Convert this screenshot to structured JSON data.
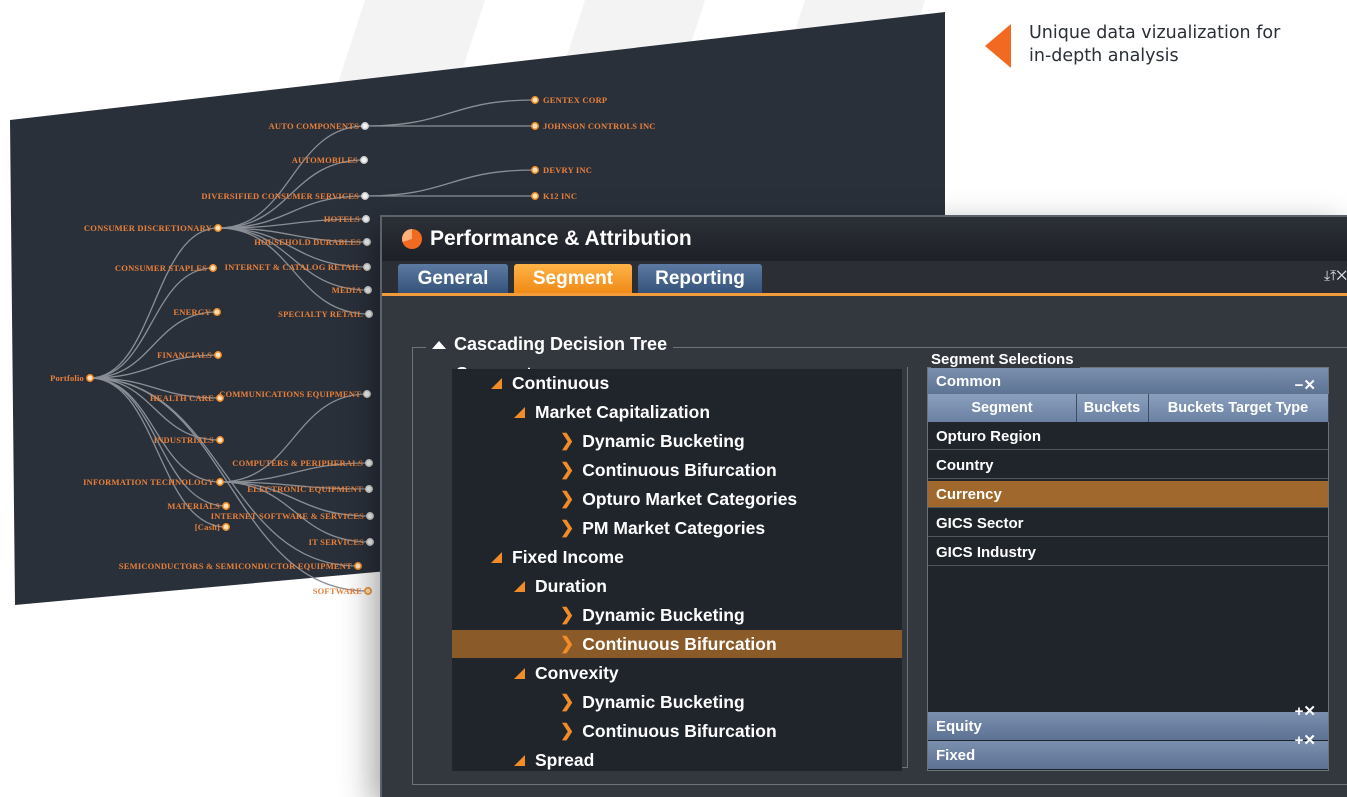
{
  "callout": {
    "text_line1": "Unique data vizualization for",
    "text_line2": "in-depth analysis"
  },
  "tree_viz": {
    "root": "Portfolio",
    "sectors": [
      "CONSUMER DISCRETIONARY",
      "CONSUMER STAPLES",
      "ENERGY",
      "FINANCIALS",
      "HEALTH CARE",
      "INDUSTRIALS",
      "INFORMATION TECHNOLOGY",
      "MATERIALS",
      "[Cash]",
      "SEMICONDUCTORS & SEMICONDUCTOR EQUIPMENT",
      "SOFTWARE"
    ],
    "industries": [
      "AUTO COMPONENTS",
      "AUTOMOBILES",
      "DIVERSIFIED CONSUMER SERVICES",
      "HOTELS",
      "HOUSEHOLD DURABLES",
      "INTERNET & CATALOG RETAIL",
      "MEDIA",
      "SPECIALTY RETAIL",
      "COMMUNICATIONS EQUIPMENT",
      "COMPUTERS & PERIPHERALS",
      "ELECTRONIC EQUIPMENT",
      "INTERNET SOFTWARE & SERVICES",
      "IT SERVICES"
    ],
    "companies": [
      "GENTEX CORP",
      "JOHNSON CONTROLS INC",
      "DEVRY INC",
      "K12 INC"
    ]
  },
  "window": {
    "title": "Performance & Attribution",
    "tabs": [
      "General",
      "Segment",
      "Reporting"
    ],
    "active_tab": "Segment",
    "controls": "⤓⤒✕"
  },
  "cascading": {
    "title": "Cascading Decision Tree",
    "segments_title": "Segments",
    "nodes": [
      {
        "label": "Continuous",
        "kind": "branch"
      },
      {
        "label": "Market Capitalization",
        "kind": "branch"
      },
      {
        "label": "Dynamic Bucketing",
        "kind": "leaf"
      },
      {
        "label": "Continuous Bifurcation",
        "kind": "leaf"
      },
      {
        "label": "Opturo Market Categories",
        "kind": "leaf"
      },
      {
        "label": "PM Market Categories",
        "kind": "leaf"
      },
      {
        "label": "Fixed Income",
        "kind": "branch"
      },
      {
        "label": "Duration",
        "kind": "branch"
      },
      {
        "label": "Dynamic Bucketing",
        "kind": "leaf"
      },
      {
        "label": "Continuous Bifurcation",
        "kind": "leaf",
        "selected": true
      },
      {
        "label": "Convexity",
        "kind": "branch"
      },
      {
        "label": "Dynamic Bucketing",
        "kind": "leaf"
      },
      {
        "label": "Continuous Bifurcation",
        "kind": "leaf"
      },
      {
        "label": "Spread",
        "kind": "branch"
      }
    ]
  },
  "selections": {
    "title": "Segment Selections",
    "common_label": "Common",
    "common_ctrl": "−✕",
    "columns": [
      "Segment",
      "Buckets",
      "Buckets Target Type"
    ],
    "rows": [
      {
        "label": "Opturo Region"
      },
      {
        "label": "Country"
      },
      {
        "label": "Currency",
        "selected": true
      },
      {
        "label": "GICS Sector"
      },
      {
        "label": "GICS Industry"
      }
    ],
    "equity_label": "Equity",
    "fixed_label": "Fixed",
    "footer_ctrl": "+✕"
  },
  "colors": {
    "accent_orange": "#f26a21",
    "selection_brown": "#8a5a28",
    "panel_dark": "#2a303a"
  }
}
